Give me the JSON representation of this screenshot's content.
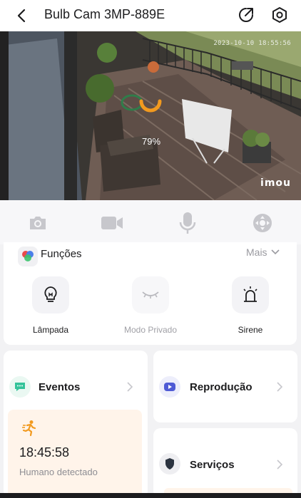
{
  "header": {
    "title": "Bulb Cam 3MP-889E",
    "back_icon": "back-arrow-icon",
    "share_icon": "share-export-icon",
    "settings_icon": "settings-hexagon-icon"
  },
  "video": {
    "timestamp": "2023-10-10 18:55:56",
    "brand": "imou",
    "loading_percent": "79%",
    "spinner_color": "#f29a1f"
  },
  "toolbar": {
    "items": [
      "camera-icon",
      "video-record-icon",
      "microphone-icon",
      "joystick-icon"
    ]
  },
  "functions": {
    "title": "Funções",
    "more_label": "Mais",
    "items": [
      {
        "label": "Lâmpada",
        "icon": "bulb-icon",
        "enabled": true
      },
      {
        "label": "Modo Privado",
        "icon": "closed-eye-icon",
        "enabled": false
      },
      {
        "label": "Sirene",
        "icon": "siren-icon",
        "enabled": true
      }
    ]
  },
  "events": {
    "title": "Eventos",
    "icon": "chat-bubble-icon",
    "time": "18:45:58",
    "description": "Humano detectado",
    "event_icon": "running-person-icon",
    "accent": "#f29a1f"
  },
  "playback": {
    "title": "Reprodução",
    "icon": "play-video-icon",
    "accent": "#4f5bd5"
  },
  "services": {
    "title": "Serviços",
    "icon": "shield-icon"
  },
  "colors": {
    "chat_green": "#34c39a",
    "orange": "#f29a1f"
  }
}
